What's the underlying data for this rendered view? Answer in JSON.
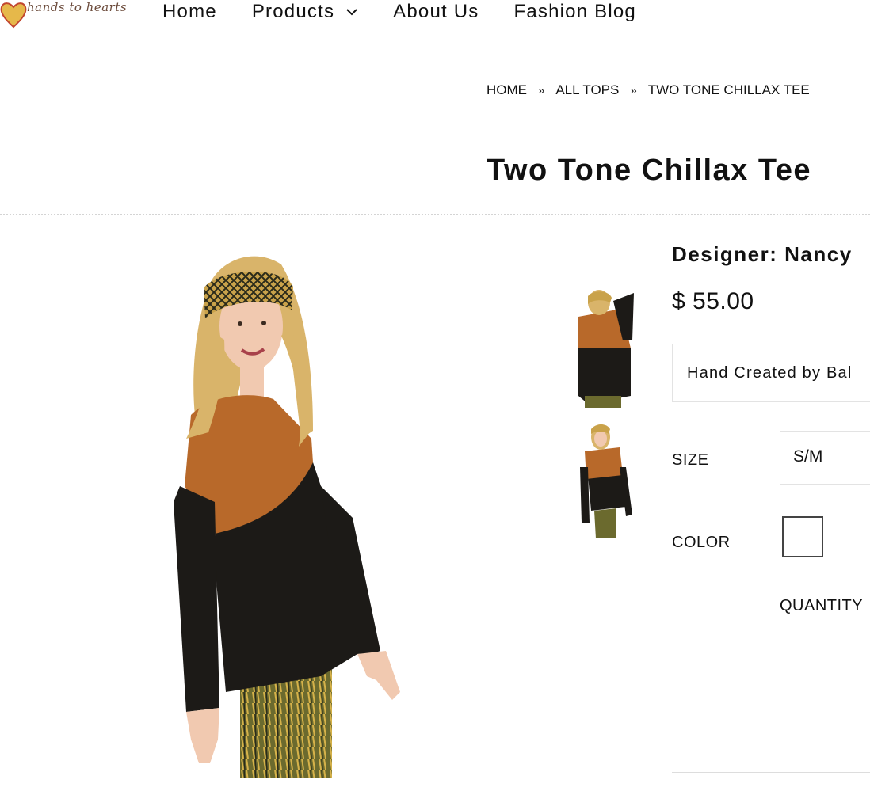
{
  "logo": {
    "text": "hands to hearts"
  },
  "nav": {
    "items": [
      {
        "label": "Home"
      },
      {
        "label": "Products",
        "has_dropdown": true
      },
      {
        "label": "About Us"
      },
      {
        "label": "Fashion Blog"
      }
    ]
  },
  "breadcrumb": {
    "items": [
      "HOME",
      "ALL TOPS",
      "TWO TONE CHILLAX TEE"
    ],
    "separator": "»"
  },
  "product": {
    "title": "Two Tone Chillax Tee",
    "designer": "Designer: Nancy",
    "price": "$ 55.00",
    "description": "Hand Created by Bal",
    "size_label": "SIZE",
    "size_value": "S/M",
    "color_label": "COLOR",
    "quantity_label": "QUANTITY"
  },
  "colors": {
    "tee_top": "#b8692a",
    "tee_bottom": "#1c1a17",
    "hair": "#d9b46a",
    "skin": "#f1c9b0"
  }
}
